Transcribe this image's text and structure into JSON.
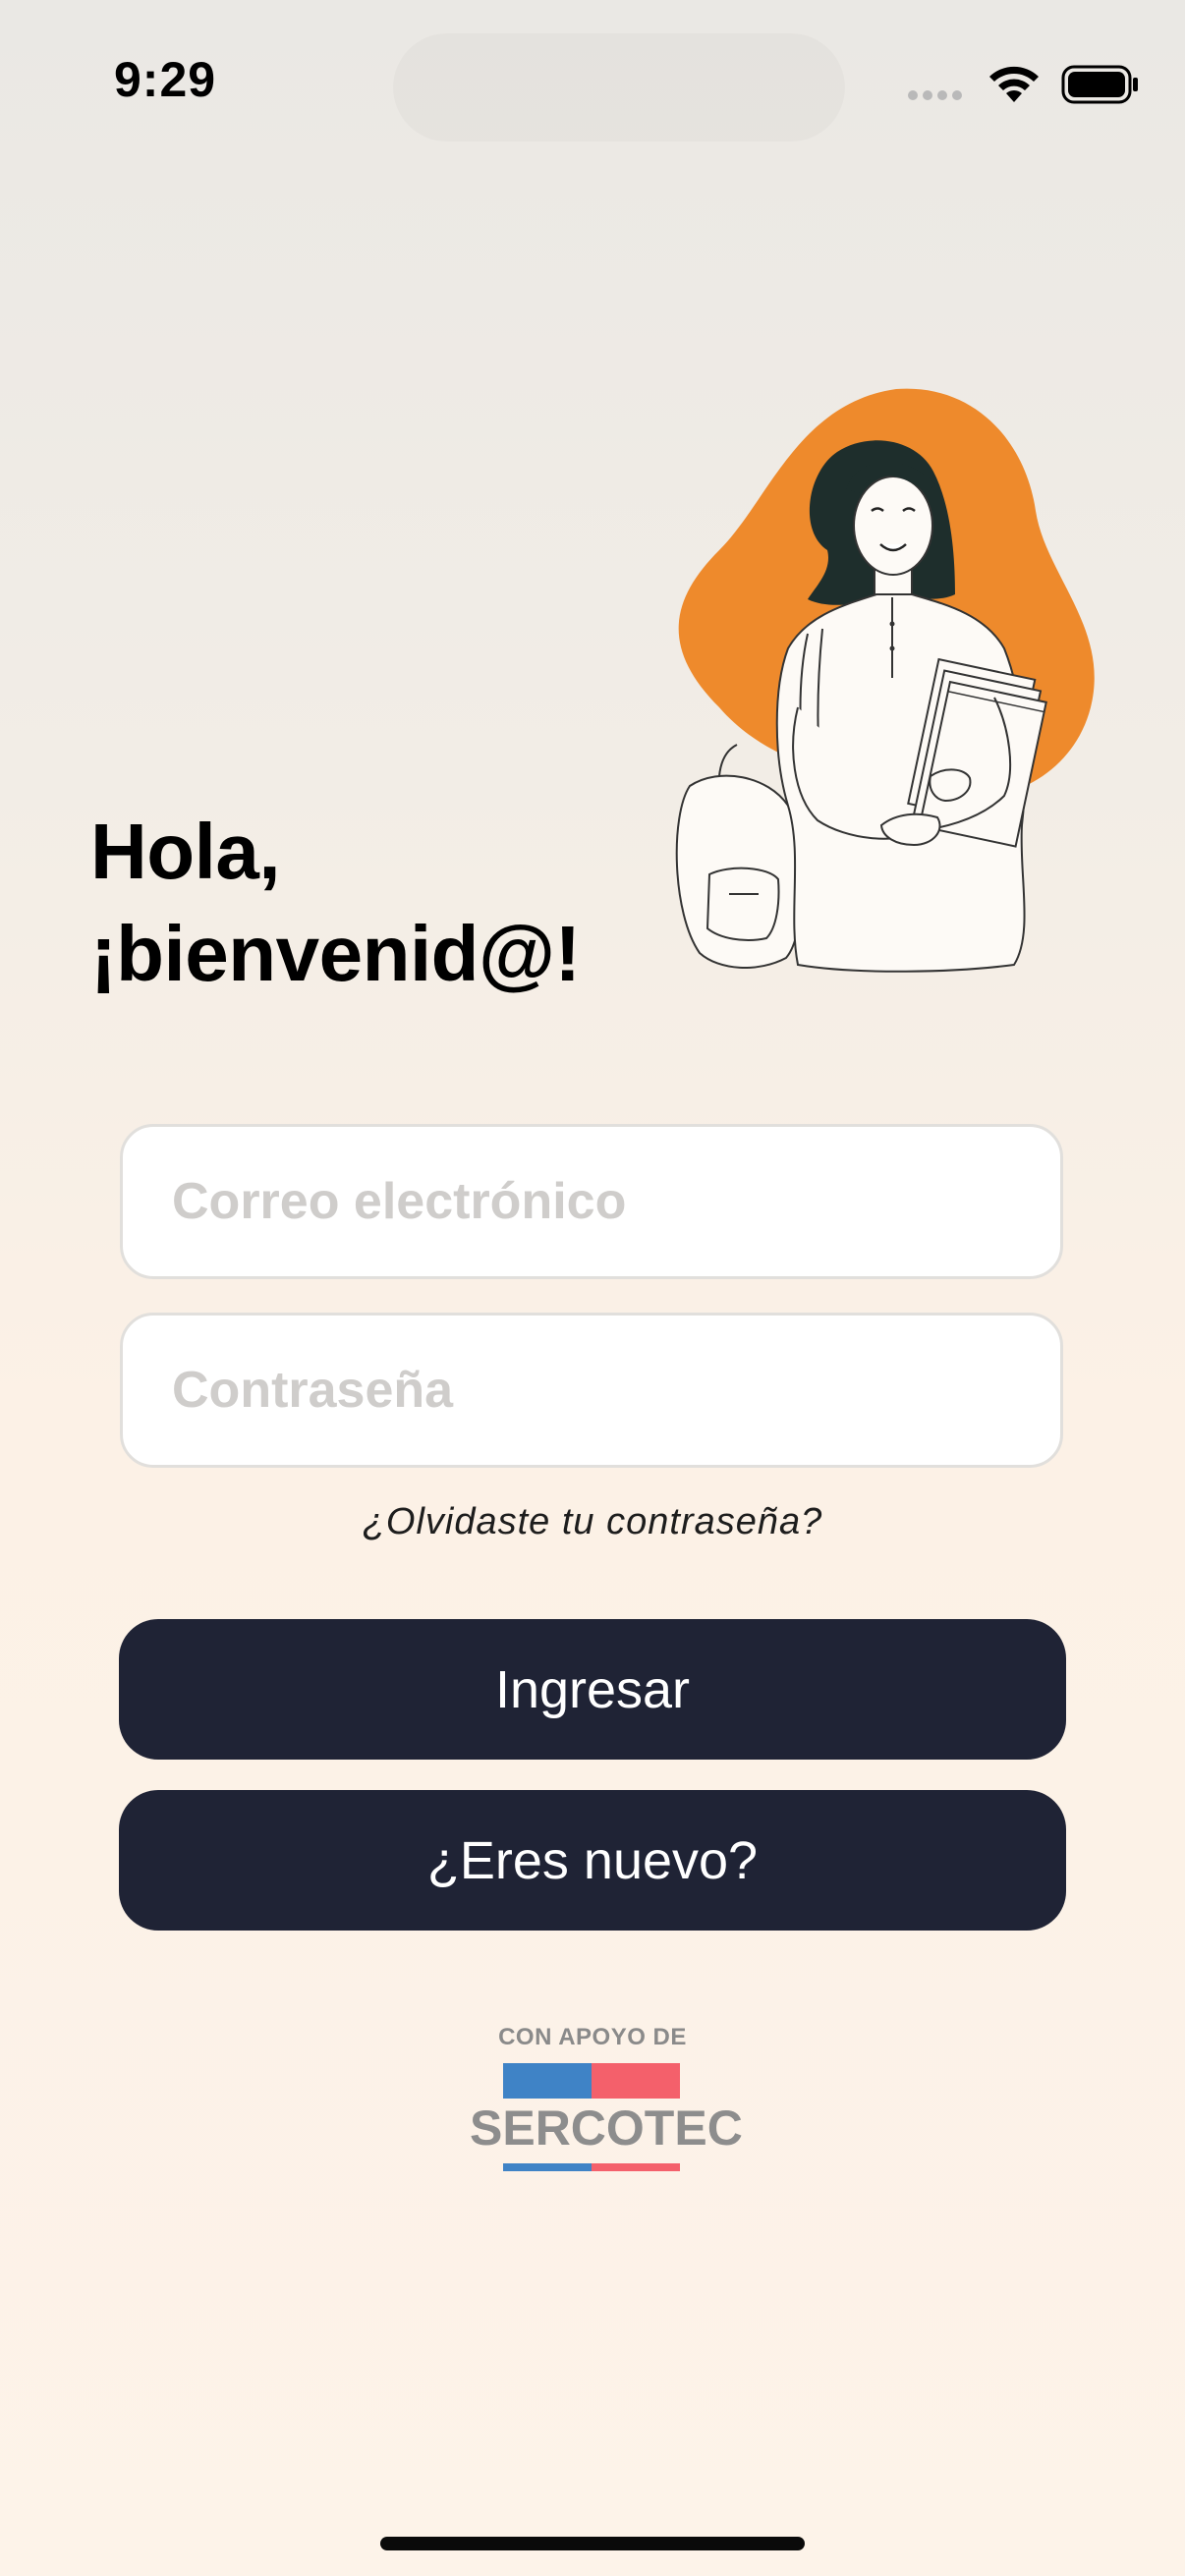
{
  "status_bar": {
    "time": "9:29",
    "icons": [
      "signal-dots-icon",
      "wifi-icon",
      "battery-icon"
    ]
  },
  "illustration": {
    "name": "student-woman-illustration",
    "accent_color": "#ee8a2c"
  },
  "greeting": {
    "line1": "Hola,",
    "line2": "¡bienvenid@!"
  },
  "form": {
    "email_placeholder": "Correo electrónico",
    "email_value": "",
    "password_placeholder": "Contraseña",
    "password_value": ""
  },
  "forgot_password": "¿Olvidaste tu contraseña?",
  "buttons": {
    "login": "Ingresar",
    "register": "¿Eres nuevo?"
  },
  "support": {
    "caption": "CON APOYO DE",
    "brand": "SERCOTEC"
  },
  "colors": {
    "button_bg": "#1f2335",
    "button_text": "#ffffff",
    "flag_blue": "#3f83c6",
    "flag_red": "#f4606b"
  }
}
